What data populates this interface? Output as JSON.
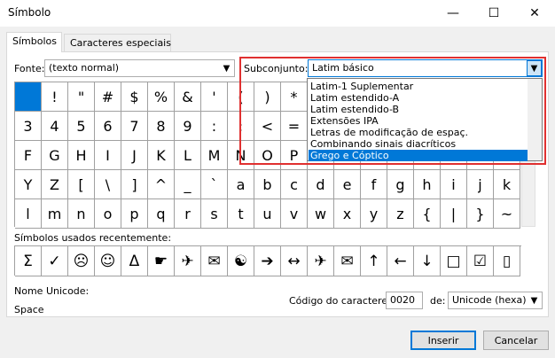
{
  "window": {
    "title": "Símbolo",
    "minimize": "—",
    "maximize": "☐",
    "close": "✕"
  },
  "tabs": [
    {
      "label": "Símbolos"
    },
    {
      "label": "Caracteres especiais"
    }
  ],
  "font": {
    "label": "Fonte:",
    "value": "(texto normal)"
  },
  "subset": {
    "label": "Subconjunto:",
    "value": "Latim básico",
    "options": [
      "Latim-1 Suplementar",
      "Latim estendido-A",
      "Latim estendido-B",
      "Extensões IPA",
      "Letras de modificação de espaç.",
      "Combinando sinais diacríticos",
      "Grego e Cóptico"
    ],
    "selected_index": 6
  },
  "grid": {
    "rows": [
      [
        " ",
        "!",
        "\"",
        "#",
        "$",
        "%",
        "&",
        "'",
        "(",
        ")",
        "*",
        "",
        "",
        "",
        "",
        "",
        "",
        "",
        ""
      ],
      [
        "3",
        "4",
        "5",
        "6",
        "7",
        "8",
        "9",
        ":",
        ";",
        "<",
        "=",
        "",
        "",
        "",
        "",
        "",
        "",
        "",
        ""
      ],
      [
        "F",
        "G",
        "H",
        "I",
        "J",
        "K",
        "L",
        "M",
        "N",
        "O",
        "P",
        "",
        "",
        "",
        "",
        "",
        "",
        "",
        ""
      ],
      [
        "Y",
        "Z",
        "[",
        "\\",
        "]",
        "^",
        "_",
        "`",
        "a",
        "b",
        "c",
        "d",
        "e",
        "f",
        "g",
        "h",
        "i",
        "j",
        "k"
      ],
      [
        "l",
        "m",
        "n",
        "o",
        "p",
        "q",
        "r",
        "s",
        "t",
        "u",
        "v",
        "w",
        "x",
        "y",
        "z",
        "{",
        "|",
        "}",
        "~"
      ]
    ]
  },
  "recent": {
    "label": "Símbolos usados recentemente:",
    "symbols": [
      "Σ",
      "✓",
      "☹",
      "☺",
      "Δ",
      "☛",
      "✈",
      "✉",
      "☯",
      "➔",
      "↔",
      "✈",
      "✉",
      "↑",
      "←",
      "↓",
      "□",
      "☑",
      "▯"
    ]
  },
  "unicode": {
    "name_label": "Nome Unicode:",
    "name_value": "Space",
    "code_label": "Código do caractere:",
    "code_value": "0020",
    "from_label": "de:",
    "from_value": "Unicode (hexa)"
  },
  "buttons": {
    "insert": "Inserir",
    "cancel": "Cancelar"
  }
}
